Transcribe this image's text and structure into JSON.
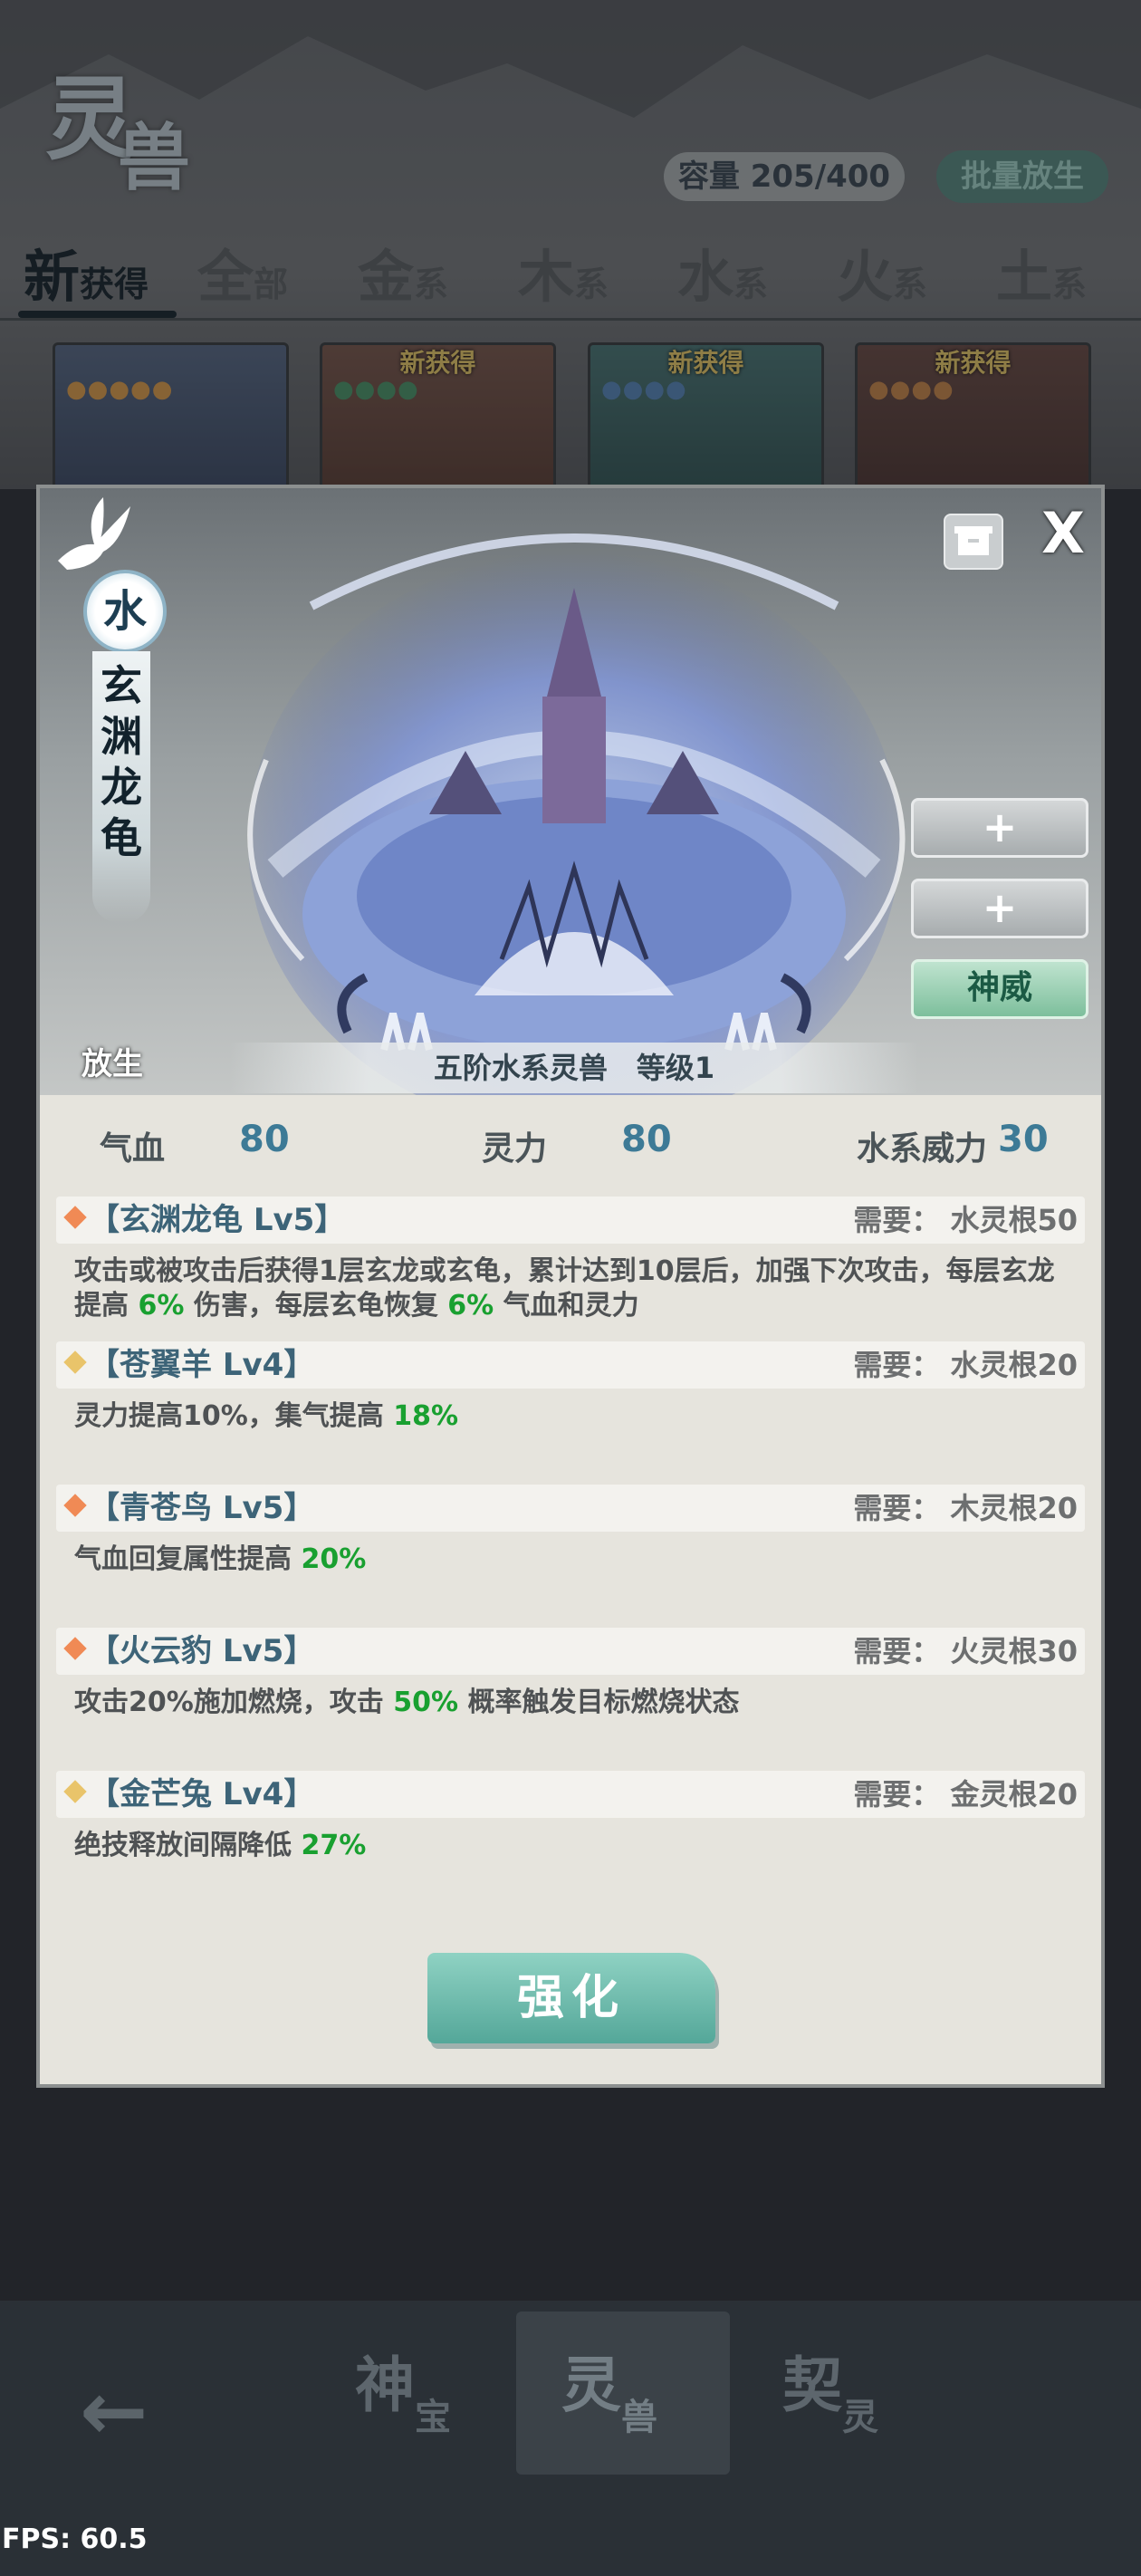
{
  "app": {
    "logo": [
      "灵",
      "兽"
    ],
    "capacity": "容量 205/400",
    "batch_release": "批量放生",
    "tabs": [
      {
        "big": "新",
        "small": "获得"
      },
      {
        "big": "全",
        "small": "部"
      },
      {
        "big": "金",
        "small": "系"
      },
      {
        "big": "木",
        "small": "系"
      },
      {
        "big": "水",
        "small": "系"
      },
      {
        "big": "火",
        "small": "系"
      },
      {
        "big": "土",
        "small": "系"
      }
    ],
    "card_new_tag": "新获得"
  },
  "modal": {
    "element": "水",
    "beast_name": "玄渊龙龟",
    "release_label": "放生",
    "close_label": "X",
    "side_buttons": [
      "+",
      "+",
      "神威"
    ],
    "level_text": "五阶水系灵兽　等级1",
    "stats": [
      {
        "label": "气血",
        "value": "80"
      },
      {
        "label": "灵力",
        "value": "80"
      },
      {
        "label": "水系威力",
        "value": "30"
      }
    ],
    "skills": [
      {
        "name": "【玄渊龙龟 Lv5】",
        "req": "需要：  水灵根50",
        "diamond": "#f08a55",
        "desc": [
          {
            "t": "攻击或被攻击后获得1层玄龙或玄龟，累计达到10层后，加强下次攻击，每层玄龙提高 "
          },
          {
            "t": "6%",
            "hl": true
          },
          {
            "t": " 伤害，每层玄龟恢复 "
          },
          {
            "t": "6%",
            "hl": true
          },
          {
            "t": " 气血和灵力"
          }
        ]
      },
      {
        "name": "【苍翼羊 Lv4】",
        "req": "需要：  水灵根20",
        "diamond": "#e9c46a",
        "desc": [
          {
            "t": "灵力提高10%，集气提高 "
          },
          {
            "t": "18%",
            "hl": true
          }
        ]
      },
      {
        "name": "【青苍鸟 Lv5】",
        "req": "需要：  木灵根20",
        "diamond": "#f08a55",
        "desc": [
          {
            "t": "气血回复属性提高 "
          },
          {
            "t": "20%",
            "hl": true
          }
        ]
      },
      {
        "name": "【火云豹 Lv5】",
        "req": "需要：  火灵根30",
        "diamond": "#f08a55",
        "desc": [
          {
            "t": "攻击20%施加燃烧，攻击 "
          },
          {
            "t": "50%",
            "hl": true
          },
          {
            "t": " 概率触发目标燃烧状态"
          }
        ]
      },
      {
        "name": "【金芒兔 Lv4】",
        "req": "需要：  金灵根20",
        "diamond": "#e9c46a",
        "desc": [
          {
            "t": "绝技释放间隔降低 "
          },
          {
            "t": "27%",
            "hl": true
          }
        ]
      }
    ],
    "strengthen_label": "强化"
  },
  "nav": {
    "items": [
      {
        "big": "神",
        "small": "宝"
      },
      {
        "big": "灵",
        "small": "兽"
      },
      {
        "big": "契",
        "small": "灵"
      }
    ]
  },
  "fps": "FPS: 60.5"
}
